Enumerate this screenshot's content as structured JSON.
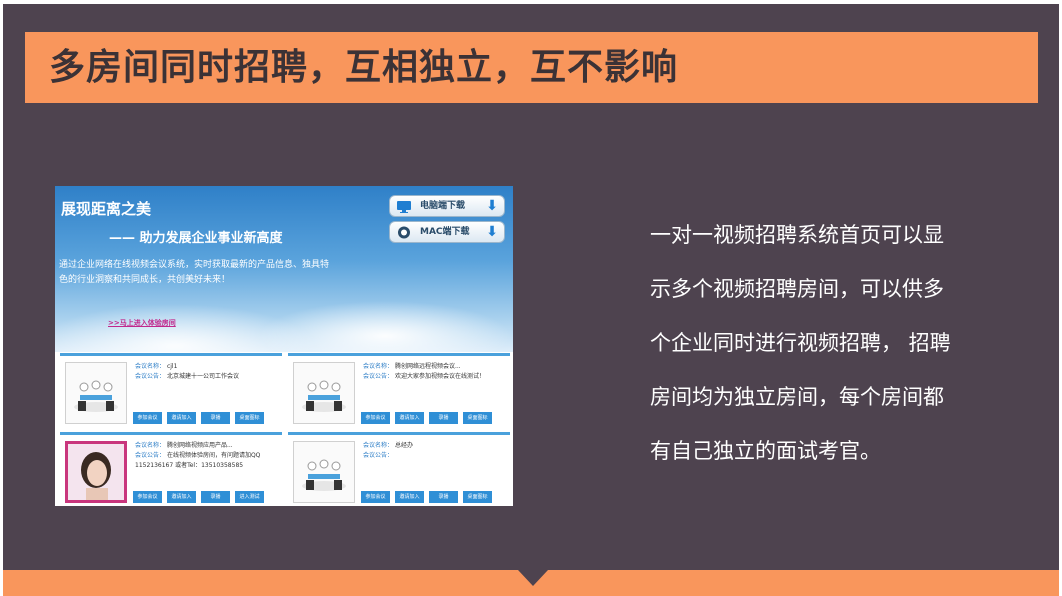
{
  "title": "多房间同时招聘，互相独立，互不影响",
  "description_lines": [
    " 一对一视频招聘系统首页可以显",
    "示多个视频招聘房间，可以供多",
    "个企业同时进行视频招聘， 招聘",
    "房间均为独立房间，每个房间都",
    "有自己独立的面试考官。"
  ],
  "screenshot": {
    "banner_title": "展现距离之美",
    "banner_subtitle": "—— 助力发展企业事业新高度",
    "banner_desc": "通过企业网络在线视频会议系统，实时获取最新的产品信息、独具特色的行业洞察和共同成长，共创美好未来！",
    "banner_link": ">>马上进入体验房间",
    "pc_download": "电脑端下载",
    "mac_download": "MAC端下载",
    "rooms": [
      {
        "name_label": "会议名称：",
        "name_value": "cjl1",
        "notice_label": "会议公告：",
        "notice_value": "北京城建十一公司工作会议",
        "extra": "",
        "buttons": [
          "参加会议",
          "邀请加入",
          "录播",
          "桌面图标"
        ]
      },
      {
        "name_label": "会议名称：",
        "name_value": "腾创网络远程视频会议...",
        "notice_label": "会议公告：",
        "notice_value": "欢迎大家参加视频会议在线测试！",
        "extra": "",
        "buttons": [
          "参加会议",
          "邀请加入",
          "录播",
          "桌面图标"
        ]
      },
      {
        "name_label": "会议名称：",
        "name_value": "腾创网络视频应用产品...",
        "notice_label": "会议公告：",
        "notice_value": "在线视频体验房间，有问题请加QQ",
        "extra": "1152136167 或者Tel：13510358585",
        "buttons": [
          "参加会议",
          "邀请加入",
          "录播",
          "进入测试"
        ]
      },
      {
        "name_label": "会议名称：",
        "name_value": "总经办",
        "notice_label": "会议公告：",
        "notice_value": "",
        "extra": "",
        "buttons": [
          "参加会议",
          "邀请加入",
          "录播",
          "桌面图标"
        ]
      }
    ]
  },
  "colors": {
    "background": "#4e434f",
    "accent": "#f9965c",
    "title_text": "#3b3236",
    "room_button": "#2f8fd6"
  }
}
